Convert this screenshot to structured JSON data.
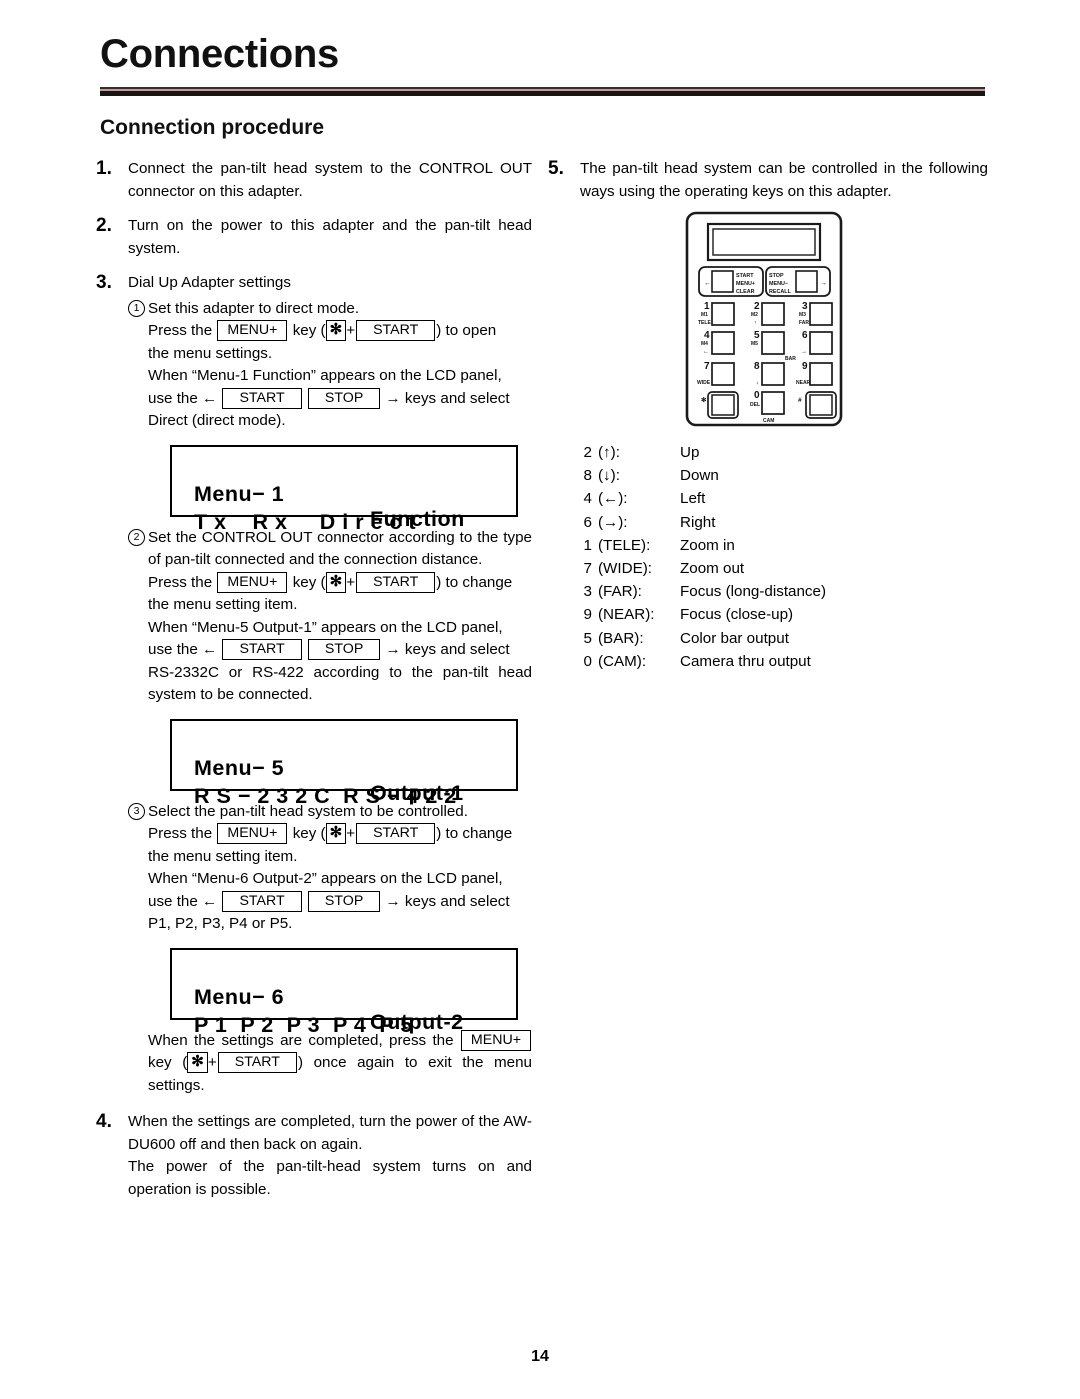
{
  "header": {
    "title": "Connections",
    "section_heading": "Connection procedure"
  },
  "keys": {
    "menu_plus": "MENU+",
    "start": "START",
    "stop": "STOP",
    "star": "✻"
  },
  "left_column": {
    "step1": {
      "num": "1.",
      "text": "Connect the pan-tilt head system to the CONTROL OUT connector on this adapter."
    },
    "step2": {
      "num": "2.",
      "text": "Turn on the power to this adapter and the pan-tilt head system."
    },
    "step3": {
      "num": "3.",
      "title": "Dial Up Adapter settings",
      "sub1": {
        "marker": "1",
        "heading": "Set this adapter to direct mode.",
        "line_a_pre": "Press the",
        "line_a_mid": "key (",
        "line_a_plus": "+",
        "line_a_post": ") to open",
        "line_b": "the menu settings.",
        "line_c": "When “Menu-1 Function” appears on the LCD panel,",
        "line_d_pre": "use the ←",
        "line_d_post": "→ keys and select",
        "line_e": "Direct (direct mode)."
      },
      "lcd1": {
        "l1_a": "Menu− 1",
        "l1_b": "Function",
        "l2_a": "T x    R x     D i r e c t"
      },
      "sub2": {
        "marker": "2",
        "heading": "Set the CONTROL OUT connector according to the type of pan-tilt connected and the connection distance.",
        "line_a_pre": "Press the",
        "line_a_mid": "key (",
        "line_a_plus": "+",
        "line_a_post": ") to change",
        "line_b": "the menu setting item.",
        "line_c": "When “Menu-5 Output-1” appears on the LCD panel,",
        "line_d_pre": "use the ←",
        "line_d_post": "→ keys and select",
        "line_e": "RS-2332C or RS-422 according to the pan-tilt head system to be connected."
      },
      "lcd2": {
        "l1_a": "Menu− 5",
        "l1_b": "Output-1",
        "l2_a": "R S − 2 3 2 C  R S − 4 2 2"
      },
      "sub3": {
        "marker": "3",
        "heading": "Select the pan-tilt head system to be controlled.",
        "line_a_pre": "Press the",
        "line_a_mid": "key (",
        "line_a_plus": "+",
        "line_a_post": ") to change",
        "line_b": "the menu setting item.",
        "line_c": "When “Menu-6 Output-2” appears on the LCD panel,",
        "line_d_pre": "use the ←",
        "line_d_post": "→ keys and select",
        "line_e": "P1, P2, P3, P4 or P5."
      },
      "lcd3": {
        "l1_a": "Menu− 6",
        "l1_b": "Output-2",
        "l2_a": "P 1  P 2  P 3  P 4  P 5"
      },
      "closing": {
        "line_a_pre": "When the settings are completed, press the",
        "line_b_pre": "key (",
        "line_b_plus": "+",
        "line_b_post": ") once again to exit the menu settings."
      }
    },
    "step4": {
      "num": "4.",
      "text_a": "When the settings are completed, turn the power of the AW-DU600 off and then back on again.",
      "text_b": "The power of the pan-tilt-head system turns on and operation is possible."
    }
  },
  "right_column": {
    "step5": {
      "num": "5.",
      "text": "The pan-tilt head system can be controlled in the following ways using the operating keys on this adapter."
    },
    "device": {
      "label_start": "START",
      "label_menu_plus": "MENU+",
      "label_clear": "CLEAR",
      "label_stop": "STOP",
      "label_menu_minus": "MENU−",
      "label_recall": "RECALL",
      "arrow_left": "←",
      "arrow_right": "→",
      "keys": [
        {
          "digit": "1",
          "sub1": "M1",
          "sub2": "TELE"
        },
        {
          "digit": "2",
          "sub1": "M2",
          "sub2": "↑"
        },
        {
          "digit": "3",
          "sub1": "M3",
          "sub2": "FAR"
        },
        {
          "digit": "4",
          "sub1": "M4",
          "sub2": "←"
        },
        {
          "digit": "5",
          "sub1": "M5",
          "sub2": "BAR"
        },
        {
          "digit": "6",
          "sub1": "",
          "sub2": "→"
        },
        {
          "digit": "7",
          "sub1": "",
          "sub2": "WIDE"
        },
        {
          "digit": "8",
          "sub1": "",
          "sub2": "↓"
        },
        {
          "digit": "9",
          "sub1": "",
          "sub2": "NEAR"
        },
        {
          "digit": "✻",
          "sub1": "",
          "sub2": ""
        },
        {
          "digit": "0",
          "sub1": "DEL",
          "sub2": "CAM"
        },
        {
          "digit": "#",
          "sub1": "",
          "sub2": ""
        }
      ]
    },
    "functions": [
      {
        "num": "2",
        "key": "(↑):",
        "desc": "Up"
      },
      {
        "num": "8",
        "key": "(↓):",
        "desc": "Down"
      },
      {
        "num": "4",
        "key": "(←):",
        "desc": "Left"
      },
      {
        "num": "6",
        "key": "(→):",
        "desc": "Right"
      },
      {
        "num": "1",
        "key": "(TELE):",
        "desc": "Zoom in"
      },
      {
        "num": "7",
        "key": "(WIDE):",
        "desc": "Zoom out"
      },
      {
        "num": "3",
        "key": "(FAR):",
        "desc": "Focus (long-distance)"
      },
      {
        "num": "9",
        "key": "(NEAR):",
        "desc": "Focus (close-up)"
      },
      {
        "num": "5",
        "key": "(BAR):",
        "desc": "Color bar output"
      },
      {
        "num": "0",
        "key": "(CAM):",
        "desc": "Camera thru output"
      }
    ]
  },
  "footer": {
    "page_number": "14"
  }
}
